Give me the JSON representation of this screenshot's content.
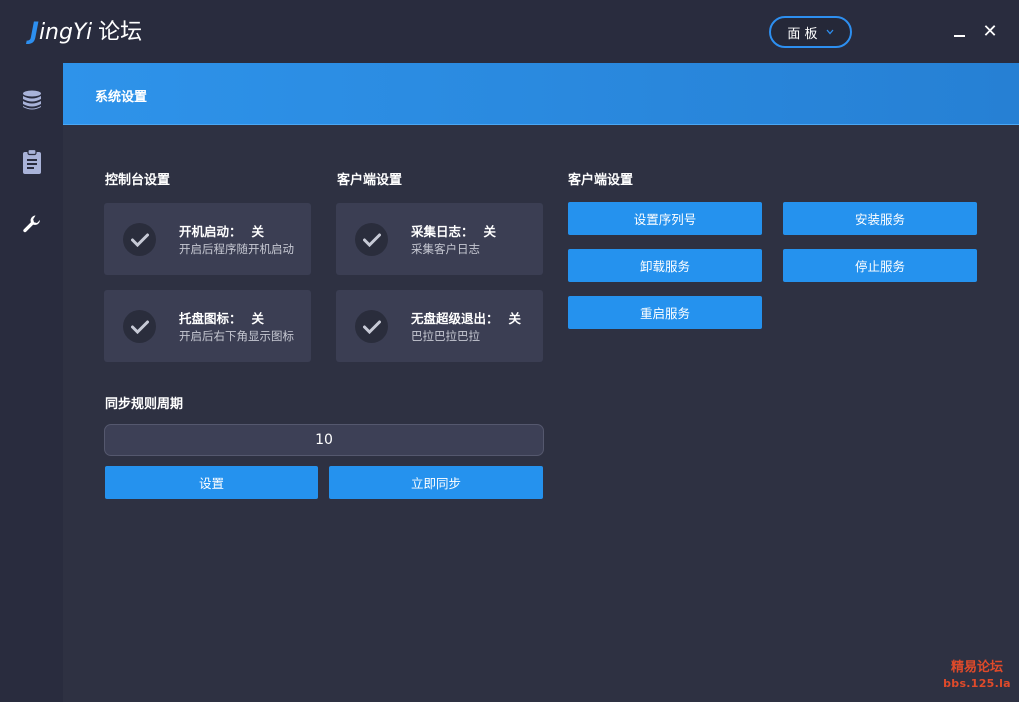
{
  "app": {
    "logo_j": "J",
    "logo_rest": "ingYi",
    "logo_cn": "论坛"
  },
  "titlebar": {
    "panel_select": "面 板",
    "minimize_icon": "minimize-icon",
    "close_icon": "close-icon",
    "close_glyph": "✕"
  },
  "sidebar": {
    "items": [
      {
        "icon": "database-icon"
      },
      {
        "icon": "clipboard-icon"
      },
      {
        "icon": "wrench-icon"
      }
    ]
  },
  "header": {
    "title": "系统设置"
  },
  "console_settings": {
    "title": "控制台设置",
    "cards": [
      {
        "title": "开机启动：",
        "value": "关",
        "desc": "开启后程序随开机启动"
      },
      {
        "title": "托盘图标：",
        "value": "关",
        "desc": "开启后右下角显示图标"
      }
    ]
  },
  "client_settings_1": {
    "title": "客户端设置",
    "cards": [
      {
        "title": "采集日志：",
        "value": "关",
        "desc": "采集客户日志"
      },
      {
        "title": "无盘超级退出：",
        "value": "关",
        "desc": "巴拉巴拉巴拉"
      }
    ]
  },
  "client_settings_2": {
    "title": "客户端设置",
    "buttons": [
      {
        "label": "设置序列号"
      },
      {
        "label": "安装服务"
      },
      {
        "label": "卸载服务"
      },
      {
        "label": "停止服务"
      },
      {
        "label": "重启服务"
      }
    ]
  },
  "sync": {
    "title": "同步规则周期",
    "value": "10",
    "set_label": "设置",
    "sync_now_label": "立即同步"
  },
  "watermark": {
    "line1": "精易论坛",
    "line2": "bbs.125.la"
  },
  "colors": {
    "accent": "#2592ee",
    "background": "#292c3e",
    "card": "#3b3e53",
    "watermark": "#e04a2a"
  }
}
